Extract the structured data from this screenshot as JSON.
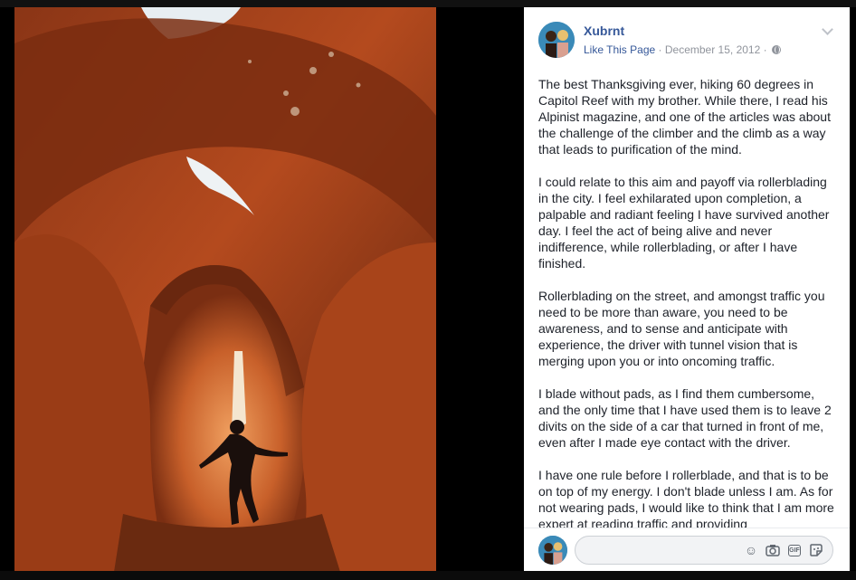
{
  "post": {
    "page_name": "Xubrnt",
    "like_link": "Like This Page",
    "separator": "·",
    "date": "December 15, 2012",
    "paragraphs": [
      "The best Thanksgiving ever, hiking 60 degrees in Capitol Reef with my brother. While there, I read his Alpinist magazine, and one of the articles was about the challenge of the climber and the climb as a way that leads to purification of the mind.",
      "I could relate to this aim and payoff via rollerblading in the city. I feel exhilarated upon completion, a palpable and radiant feeling I have survived another day. I feel the act of being alive and never indifference, while rollerblading, or after I have finished.",
      "Rollerblading on the street, and amongst traffic you need to be more than aware, you need to be awareness, and to sense and anticipate with experience, the driver with tunnel vision that is merging upon you or into oncoming traffic.",
      "I blade without pads, as I find them cumbersome, and the only time that I have used them is to leave 2 divits on the side of a car that turned in front of me, even after I made eye contact with the driver.",
      "I have one rule before I rollerblade, and that is to be on top of my energy. I don't blade unless I am. As for not wearing pads, I would like to think that I am more expert at reading traffic and providing"
    ]
  },
  "comment": {
    "placeholder": "",
    "icons": [
      "emoji-icon",
      "camera-icon",
      "gif-icon",
      "sticker-icon"
    ]
  },
  "colors": {
    "link": "#365899",
    "meta": "#90949c",
    "text": "#1d2129"
  }
}
